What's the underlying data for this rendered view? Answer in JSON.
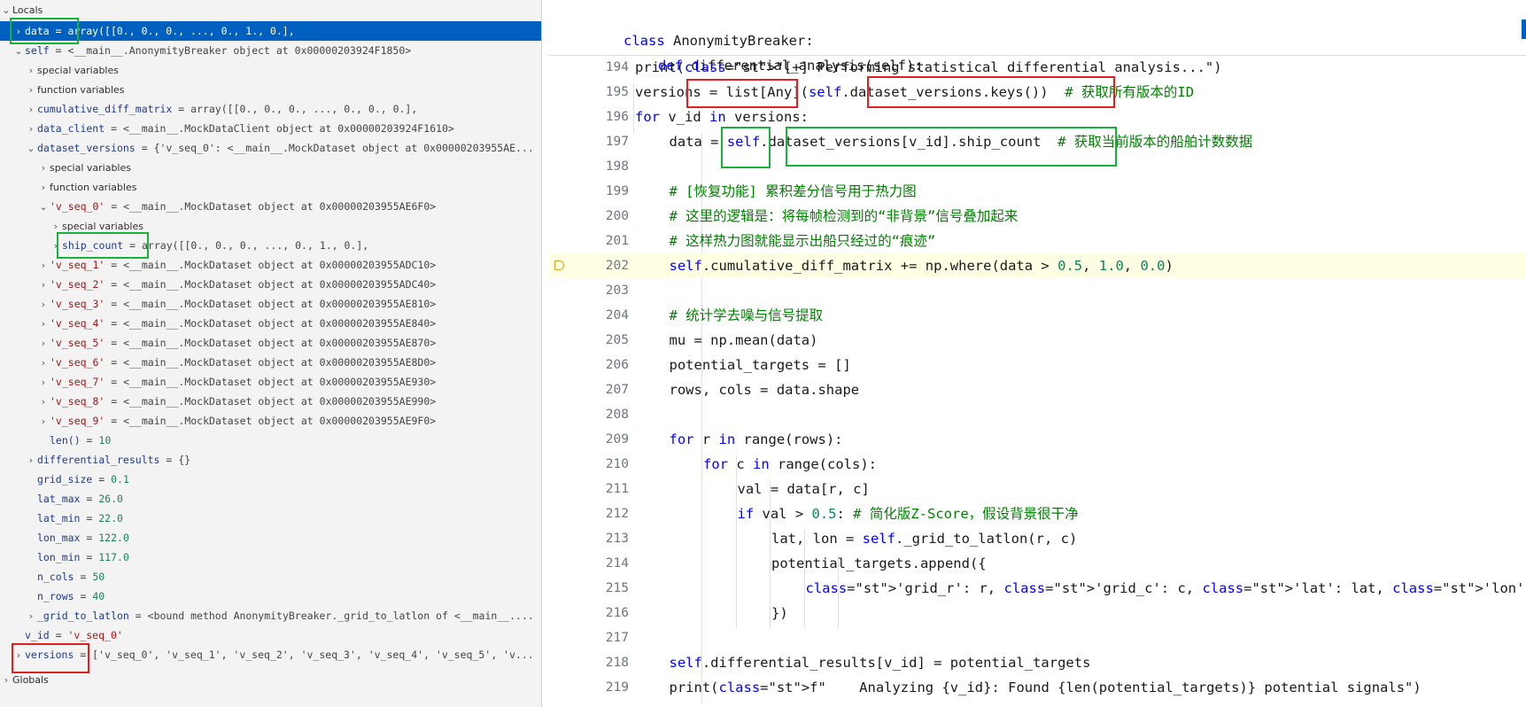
{
  "variables_panel": {
    "locals_header": "Locals",
    "globals_header": "Globals",
    "rows": [
      {
        "name": "data",
        "value": "array([[0., 0., 0., ..., 0., 1., 0.],"
      },
      {
        "name": "self",
        "value": "<__main__.AnonymityBreaker object at 0x00000203924F1850>"
      },
      {
        "name": "special variables",
        "value": ""
      },
      {
        "name": "function variables",
        "value": ""
      },
      {
        "name": "cumulative_diff_matrix",
        "value": "array([[0., 0., 0., ..., 0., 0., 0.],"
      },
      {
        "name": "data_client",
        "value": "<__main__.MockDataClient object at 0x00000203924F1610>"
      },
      {
        "name": "dataset_versions",
        "value": "{'v_seq_0': <__main__.MockDataset object at 0x00000203955AE..."
      },
      {
        "name": "special variables",
        "value": ""
      },
      {
        "name": "function variables",
        "value": ""
      },
      {
        "name": "'v_seq_0'",
        "value": "<__main__.MockDataset object at 0x00000203955AE6F0>"
      },
      {
        "name": "special variables",
        "value": ""
      },
      {
        "name": "ship_count",
        "value": "array([[0., 0., 0., ..., 0., 1., 0.],"
      },
      {
        "name": "'v_seq_1'",
        "value": "<__main__.MockDataset object at 0x00000203955ADC10>"
      },
      {
        "name": "'v_seq_2'",
        "value": "<__main__.MockDataset object at 0x00000203955ADC40>"
      },
      {
        "name": "'v_seq_3'",
        "value": "<__main__.MockDataset object at 0x00000203955AE810>"
      },
      {
        "name": "'v_seq_4'",
        "value": "<__main__.MockDataset object at 0x00000203955AE840>"
      },
      {
        "name": "'v_seq_5'",
        "value": "<__main__.MockDataset object at 0x00000203955AE870>"
      },
      {
        "name": "'v_seq_6'",
        "value": "<__main__.MockDataset object at 0x00000203955AE8D0>"
      },
      {
        "name": "'v_seq_7'",
        "value": "<__main__.MockDataset object at 0x00000203955AE930>"
      },
      {
        "name": "'v_seq_8'",
        "value": "<__main__.MockDataset object at 0x00000203955AE990>"
      },
      {
        "name": "'v_seq_9'",
        "value": "<__main__.MockDataset object at 0x00000203955AE9F0>"
      },
      {
        "name": "len()",
        "value": "10"
      },
      {
        "name": "differential_results",
        "value": "{}"
      },
      {
        "name": "grid_size",
        "value": "0.1"
      },
      {
        "name": "lat_max",
        "value": "26.0"
      },
      {
        "name": "lat_min",
        "value": "22.0"
      },
      {
        "name": "lon_max",
        "value": "122.0"
      },
      {
        "name": "lon_min",
        "value": "117.0"
      },
      {
        "name": "n_cols",
        "value": "50"
      },
      {
        "name": "n_rows",
        "value": "40"
      },
      {
        "name": "_grid_to_latlon",
        "value": "<bound method AnonymityBreaker._grid_to_latlon of <__main__...."
      },
      {
        "name": "v_id",
        "value": "'v_seq_0'"
      },
      {
        "name": "versions",
        "value": "['v_seq_0', 'v_seq_1', 'v_seq_2', 'v_seq_3', 'v_seq_4', 'v_seq_5', 'v..."
      }
    ]
  },
  "editor": {
    "sticky_lines": [
      "class AnonymityBreaker:",
      "def differential_analysis(self):"
    ],
    "line_numbers": [
      "194",
      "195",
      "196",
      "197",
      "198",
      "199",
      "200",
      "201",
      "202",
      "203",
      "204",
      "205",
      "206",
      "207",
      "208",
      "209",
      "210",
      "211",
      "212",
      "213",
      "214",
      "215",
      "216",
      "217",
      "218",
      "219"
    ],
    "code": [
      "print(\"[+] Performing statistical differential analysis...\")",
      "versions = list[Any](self.dataset_versions.keys())  # 获取所有版本的ID",
      "for v_id in versions:",
      "data = self.dataset_versions[v_id].ship_count  # 获取当前版本的船舶计数数据",
      "",
      "# [恢复功能] 累积差分信号用于热力图",
      "# 这里的逻辑是：将每帧检测到的“非背景”信号叠加起来",
      "# 这样热力图就能显示出船只经过的“痕迹”",
      "self.cumulative_diff_matrix += np.where(data > 0.5, 1.0, 0.0)",
      "",
      "# 统计学去噪与信号提取",
      "mu = np.mean(data)",
      "potential_targets = []",
      "rows, cols = data.shape",
      "",
      "for r in range(rows):",
      "for c in range(cols):",
      "val = data[r, c]",
      "if val > 0.5: # 简化版Z-Score，假设背景很干净",
      "lat, lon = self._grid_to_latlon(r, c)",
      "potential_targets.append({",
      "'grid_r': r, 'grid_c': c, 'lat': lat, 'lon': lon, 'val': val, 'version': v_id",
      "})",
      "",
      "self.differential_results[v_id] = potential_targets",
      "print(f\"    Analyzing {v_id}: Found {len(potential_targets)} potential signals\")"
    ],
    "current_line": "202",
    "colors": {
      "keyword": "#0000ff",
      "string": "#a31515",
      "comment": "#008000",
      "number": "#098658",
      "current_line_bg": "#ffffe4",
      "selection": "#0060c0"
    }
  },
  "annotations": {
    "red_box_color": "#e02020",
    "green_box_color": "#17b23a"
  }
}
